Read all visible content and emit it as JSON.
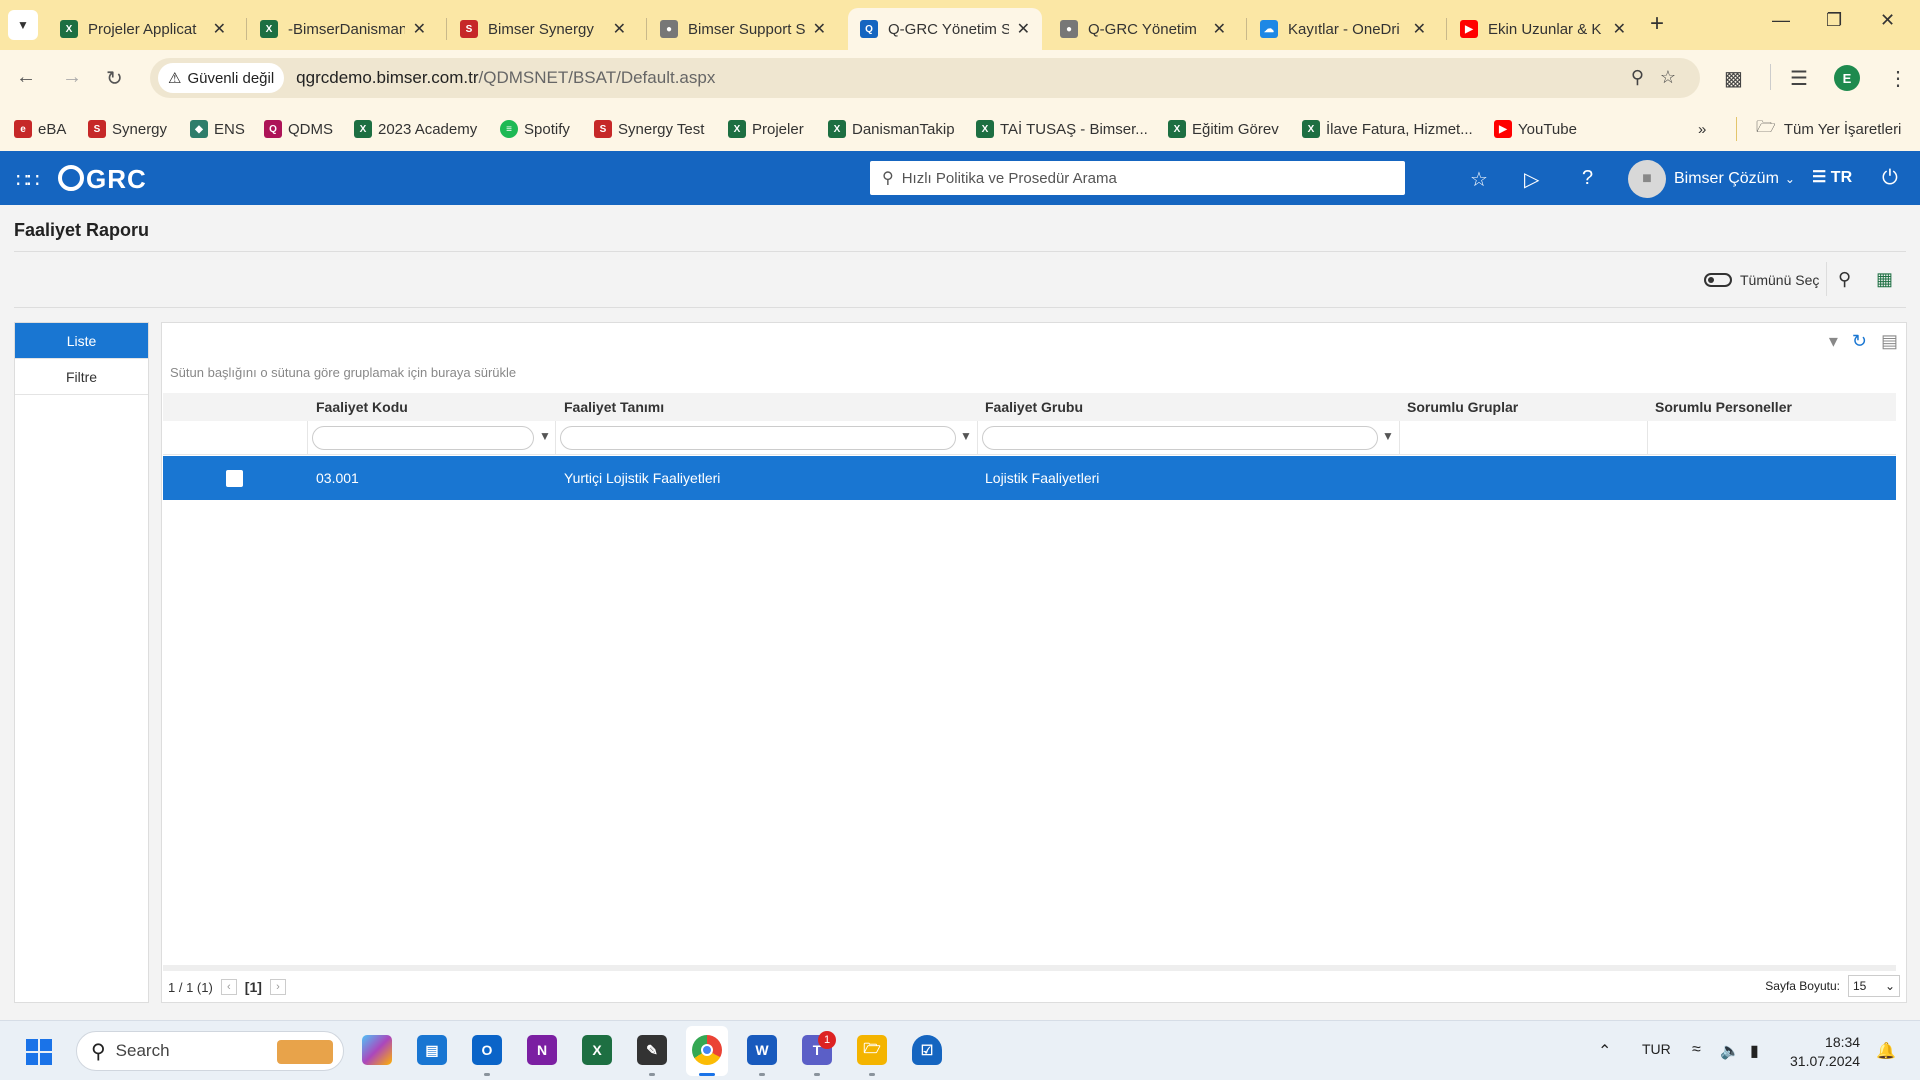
{
  "browser": {
    "tabs": [
      {
        "title": "Projeler Applicat",
        "icon": "excel-icon",
        "color": "#1d6f42"
      },
      {
        "title": "-BimserDanisman",
        "icon": "excel-icon",
        "color": "#1d6f42"
      },
      {
        "title": "Bimser Synergy",
        "icon": "synergy-icon",
        "color": "#c62828"
      },
      {
        "title": "Bimser Support S",
        "icon": "globe-icon",
        "color": "#666666"
      },
      {
        "title": "Q-GRC Yönetim S",
        "icon": "qgrc-icon",
        "color": "#1565c0",
        "active": true
      },
      {
        "title": "Q-GRC Yönetim",
        "icon": "globe-icon",
        "color": "#666666"
      },
      {
        "title": "Kayıtlar - OneDri",
        "icon": "onedrive-icon",
        "color": "#1e88e5"
      },
      {
        "title": "Ekin Uzunlar & K",
        "icon": "youtube-icon",
        "color": "#ff0000"
      }
    ],
    "security_label": "Güvenli değil",
    "url_host": "qgrcdemo.bimser.com.tr",
    "url_path": "/QDMSNET/BSAT/Default.aspx",
    "profile_initial": "E",
    "bookmarks": [
      {
        "label": "eBA",
        "icon": "eba-icon",
        "color": "#c62828"
      },
      {
        "label": "Synergy",
        "icon": "synergy-icon",
        "color": "#c62828"
      },
      {
        "label": "ENS",
        "icon": "ens-icon",
        "color": "#2e7d6b"
      },
      {
        "label": "QDMS",
        "icon": "qdms-icon",
        "color": "#ad1457"
      },
      {
        "label": "2023 Academy",
        "icon": "excel-icon",
        "color": "#1d6f42"
      },
      {
        "label": "Spotify",
        "icon": "spotify-icon",
        "color": "#1db954"
      },
      {
        "label": "Synergy Test",
        "icon": "synergy-icon",
        "color": "#c62828"
      },
      {
        "label": "Projeler",
        "icon": "excel-icon",
        "color": "#1d6f42"
      },
      {
        "label": "DanismanTakip",
        "icon": "excel-icon",
        "color": "#1d6f42"
      },
      {
        "label": "TAİ TUSAŞ - Bimser...",
        "icon": "excel-icon",
        "color": "#1d6f42"
      },
      {
        "label": "Eğitim Görev",
        "icon": "excel-icon",
        "color": "#1d6f42"
      },
      {
        "label": "İlave Fatura, Hizmet...",
        "icon": "excel-icon",
        "color": "#1d6f42"
      },
      {
        "label": "YouTube",
        "icon": "youtube-icon",
        "color": "#ff0000"
      }
    ],
    "all_bookmarks_label": "Tüm Yer İşaretleri"
  },
  "app": {
    "logo": "GRC",
    "search_placeholder": "Hızlı Politika ve Prosedür Arama",
    "user_name": "Bimser Çözüm",
    "language": "TR",
    "accent_color": "#1565c0",
    "page_title": "Faaliyet Raporu",
    "select_all_label": "Tümünü Seç",
    "left_nav": [
      {
        "label": "Liste",
        "active": true
      },
      {
        "label": "Filtre",
        "active": false
      }
    ],
    "group_hint": "Sütun başlığını o sütuna göre gruplamak için buraya sürükle",
    "columns": [
      "Faaliyet Kodu",
      "Faaliyet Tanımı",
      "Faaliyet Grubu",
      "Sorumlu Gruplar",
      "Sorumlu Personeller"
    ],
    "rows": [
      {
        "code": "03.001",
        "definition": "Yurtiçi Lojistik Faaliyetleri",
        "group": "Lojistik Faaliyetleri",
        "responsible_groups": "",
        "responsible_people": "",
        "selected": true
      }
    ],
    "pager": {
      "summary": "1 / 1 (1)",
      "current_page": "[1]",
      "page_size_label": "Sayfa Boyutu:",
      "page_size": "15"
    }
  },
  "taskbar": {
    "search_label": "Search",
    "language": "TUR",
    "time": "18:34",
    "date": "31.07.2024",
    "teams_badge": "1",
    "apps": [
      "copilot-icon",
      "widgets-icon",
      "outlook-icon",
      "onenote-icon",
      "excel-icon",
      "sticky-notes-icon",
      "chrome-icon",
      "word-icon",
      "teams-icon",
      "file-explorer-icon",
      "defender-icon"
    ]
  }
}
